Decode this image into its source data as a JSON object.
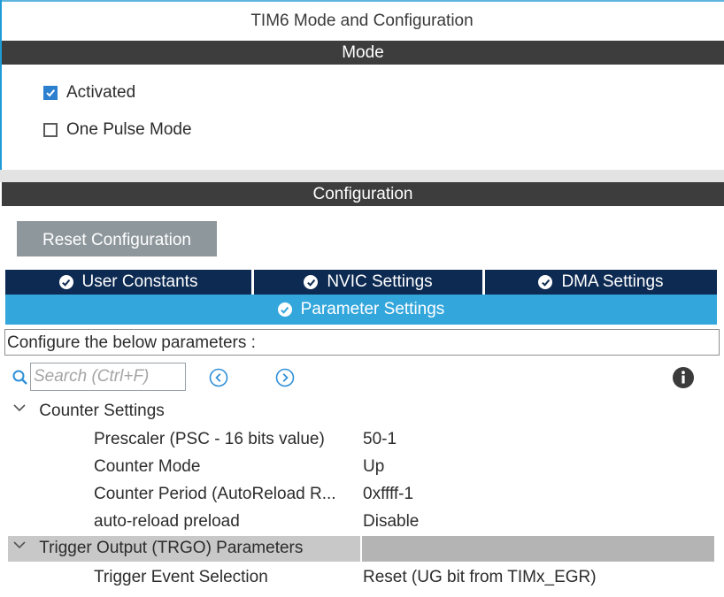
{
  "window": {
    "title": "TIM6 Mode and Configuration"
  },
  "mode": {
    "header": "Mode",
    "activated": {
      "label": "Activated",
      "checked": true
    },
    "one_pulse": {
      "label": "One Pulse Mode",
      "checked": false
    }
  },
  "configuration": {
    "header": "Configuration",
    "reset_label": "Reset Configuration",
    "tabs": [
      {
        "label": "User Constants",
        "icon": "check-circle-icon"
      },
      {
        "label": "NVIC Settings",
        "icon": "check-circle-icon"
      },
      {
        "label": "DMA Settings",
        "icon": "check-circle-icon"
      }
    ],
    "active_tab": {
      "label": "Parameter Settings",
      "icon": "check-circle-icon"
    },
    "description": "Configure the below parameters :",
    "search": {
      "placeholder": "Search (Ctrl+F)"
    },
    "groups": [
      {
        "label": "Counter Settings",
        "params": [
          {
            "label": "Prescaler (PSC - 16 bits value)",
            "value": "50-1"
          },
          {
            "label": "Counter Mode",
            "value": "Up"
          },
          {
            "label": "Counter Period (AutoReload R...",
            "value": "0xffff-1"
          },
          {
            "label": "auto-reload preload",
            "value": "Disable"
          }
        ]
      },
      {
        "label": "Trigger Output (TRGO) Parameters",
        "params": [
          {
            "label": "Trigger Event Selection",
            "value": "Reset (UG bit from TIMx_EGR)"
          }
        ]
      }
    ]
  },
  "colors": {
    "band": "#3d3d3d",
    "tab_dark": "#0d2a52",
    "tab_active": "#33a6dc",
    "checkbox": "#2d7fd0",
    "nav_icon": "#2e8fd8"
  }
}
